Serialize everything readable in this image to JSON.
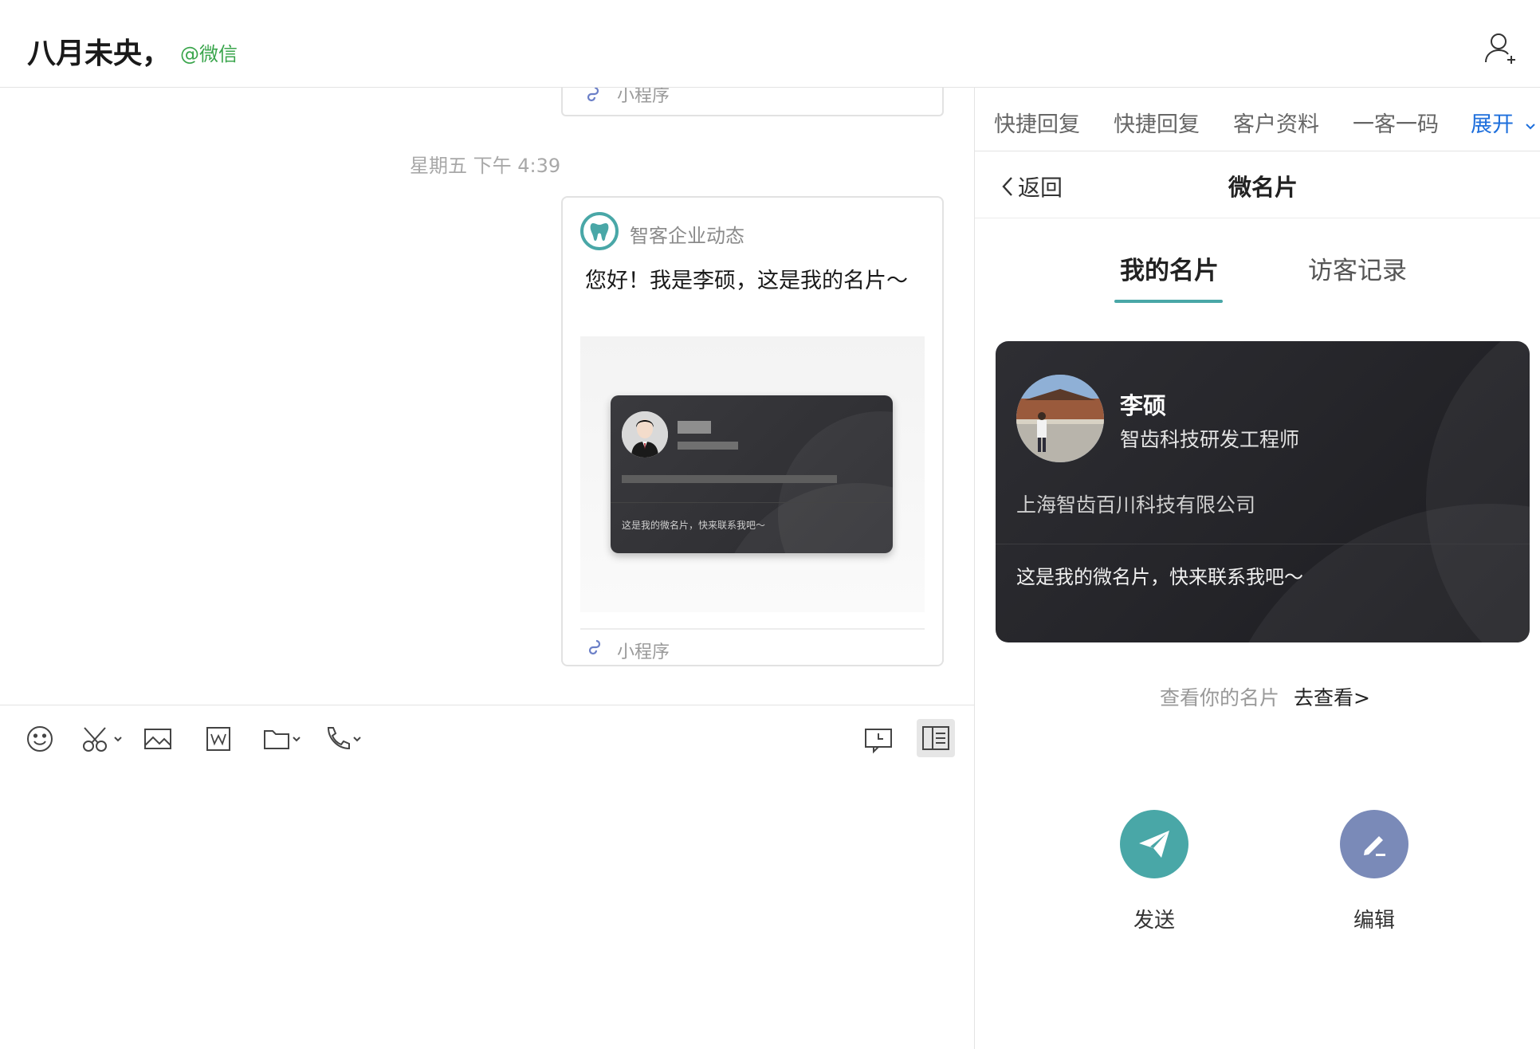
{
  "header": {
    "title": "八月未央，",
    "source": "@微信"
  },
  "chat": {
    "prev_card_footer": "小程序",
    "timestamp": "星期五 下午 4:39",
    "card": {
      "source_name": "智客企业动态",
      "text": "您好！我是李硕，这是我的名片～",
      "preview_slogan": "这是我的微名片，快来联系我吧～",
      "footer": "小程序"
    }
  },
  "panel": {
    "tabs": [
      "快捷回复",
      "快捷回复",
      "客户资料",
      "一客一码"
    ],
    "expand_label": "展开",
    "back_label": "返回",
    "title": "微名片",
    "segments": {
      "active": "我的名片",
      "inactive": "访客记录"
    },
    "card": {
      "name": "李硕",
      "role": "智齿科技研发工程师",
      "company": "上海智齿百川科技有限公司",
      "slogan": "这是我的微名片，快来联系我吧～"
    },
    "view_hint": "查看你的名片",
    "view_link": "去查看>",
    "actions": {
      "send": "发送",
      "edit": "编辑"
    }
  },
  "colors": {
    "accent_teal": "#49a7a7",
    "edit_blue": "#7a8ab8",
    "expand_blue": "#1e6fdc",
    "source_green": "#3aa54c"
  }
}
